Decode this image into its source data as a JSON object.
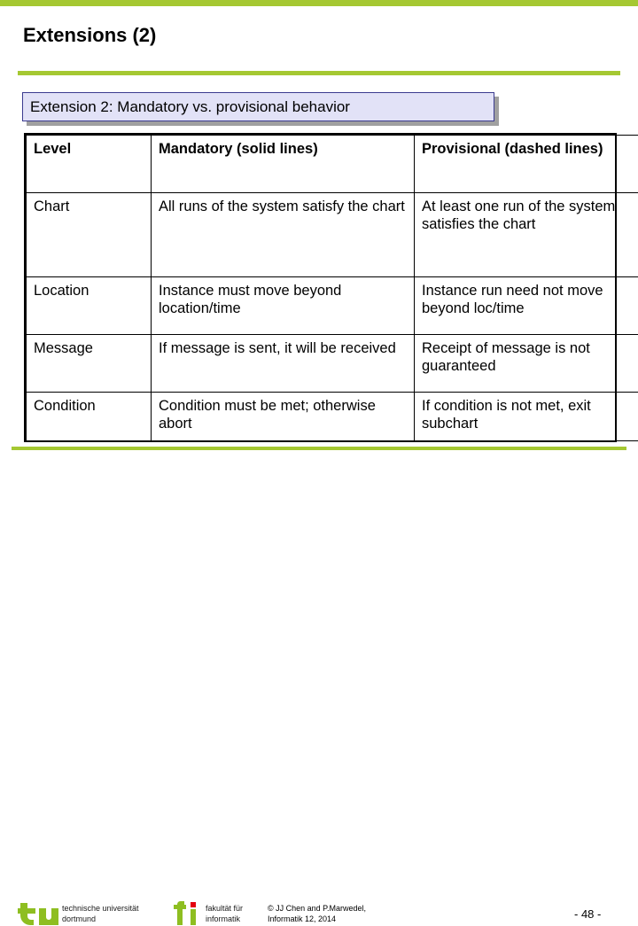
{
  "theme": {
    "accent_green": "#a5c832",
    "callout_bg": "#e2e2f7",
    "callout_border": "#3b3b8f",
    "shadow": "#a0a0a0",
    "logo_green": "#8ebe21",
    "logo_red": "#e3000f"
  },
  "header": {
    "title": "Extensions (2)"
  },
  "callout": {
    "text": "Extension 2: Mandatory vs. provisional behavior"
  },
  "table": {
    "columns": [
      "Level",
      "Mandatory (solid lines)",
      "Provisional (dashed lines)"
    ],
    "rows": [
      {
        "level": "Chart",
        "mandatory": "All runs of the system satisfy the chart",
        "provisional": "At least one run of the system satisfies the chart"
      },
      {
        "level": "Location",
        "mandatory": "Instance must move beyond location/time",
        "provisional": "Instance run need not move beyond loc/time"
      },
      {
        "level": "Message",
        "mandatory": "If message is sent, it will be received",
        "provisional": "Receipt of message is not guaranteed"
      },
      {
        "level": "Condition",
        "mandatory": "Condition must be met; otherwise abort",
        "provisional": "If condition is not met, exit subchart"
      }
    ]
  },
  "footer": {
    "university_line1": "technische universität",
    "university_line2": "dortmund",
    "faculty_line1": "fakultät für",
    "faculty_line2": "informatik",
    "copyright_line1": "© JJ Chen and  P.Marwedel,",
    "copyright_line2": "Informatik 12,  2014",
    "page_number": "- 48 -"
  }
}
